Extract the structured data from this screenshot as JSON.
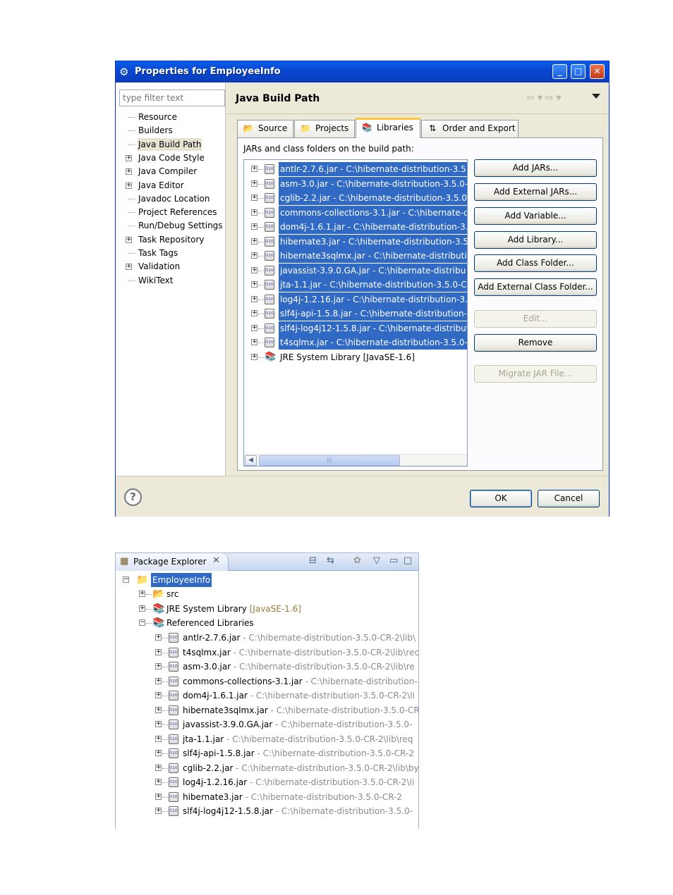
{
  "dialog": {
    "title": "Properties for EmployeeInfo",
    "filter_placeholder": "type filter text",
    "nav_items": [
      {
        "label": "Resource",
        "expandable": false
      },
      {
        "label": "Builders",
        "expandable": false
      },
      {
        "label": "Java Build Path",
        "expandable": false,
        "selected": true
      },
      {
        "label": "Java Code Style",
        "expandable": true
      },
      {
        "label": "Java Compiler",
        "expandable": true
      },
      {
        "label": "Java Editor",
        "expandable": true
      },
      {
        "label": "Javadoc Location",
        "expandable": false
      },
      {
        "label": "Project References",
        "expandable": false
      },
      {
        "label": "Run/Debug Settings",
        "expandable": false
      },
      {
        "label": "Task Repository",
        "expandable": true
      },
      {
        "label": "Task Tags",
        "expandable": false
      },
      {
        "label": "Validation",
        "expandable": true
      },
      {
        "label": "WikiText",
        "expandable": false
      }
    ],
    "page_title": "Java Build Path",
    "tabs": [
      {
        "label": "Source",
        "icon": "source-folder-icon"
      },
      {
        "label": "Projects",
        "icon": "projects-icon"
      },
      {
        "label": "Libraries",
        "icon": "libraries-icon",
        "active": true
      },
      {
        "label": "Order and Export",
        "icon": "order-export-icon"
      }
    ],
    "panel_caption": "JARs and class folders on the build path:",
    "jars": [
      "antlr-2.7.6.jar - C:\\hibernate-distribution-3.5",
      "asm-3.0.jar - C:\\hibernate-distribution-3.5.0-",
      "cglib-2.2.jar - C:\\hibernate-distribution-3.5.0",
      "commons-collections-3.1.jar - C:\\hibernate-di",
      "dom4j-1.6.1.jar - C:\\hibernate-distribution-3.",
      "hibernate3.jar - C:\\hibernate-distribution-3.5",
      "hibernate3sqlmx.jar - C:\\hibernate-distributio",
      "javassist-3.9.0.GA.jar - C:\\hibernate-distribu",
      "jta-1.1.jar - C:\\hibernate-distribution-3.5.0-C",
      "log4j-1.2.16.jar - C:\\hibernate-distribution-3.",
      "slf4j-api-1.5.8.jar - C:\\hibernate-distribution-",
      "slf4j-log4j12-1.5.8.jar - C:\\hibernate-distribut",
      "t4sqlmx.jar - C:\\hibernate-distribution-3.5.0-"
    ],
    "jre_entry": "JRE System Library [JavaSE-1.6]",
    "buttons": {
      "add_jars": "Add JARs...",
      "add_external_jars": "Add External JARs...",
      "add_variable": "Add Variable...",
      "add_library": "Add Library...",
      "add_class_folder": "Add Class Folder...",
      "add_external_class_folder": "Add External Class Folder...",
      "edit": "Edit...",
      "remove": "Remove",
      "migrate_jar": "Migrate JAR File..."
    },
    "ok": "OK",
    "cancel": "Cancel"
  },
  "package_explorer": {
    "title": "Package Explorer",
    "project": "EmployeeInfo",
    "src": "src",
    "jre_name": "JRE System Library",
    "jre_tag": "[JavaSE-1.6]",
    "referenced_libraries": "Referenced Libraries",
    "libraries": [
      {
        "name": "antlr-2.7.6.jar",
        "path": " - C:\\hibernate-distribution-3.5.0-CR-2\\lib\\"
      },
      {
        "name": "t4sqlmx.jar",
        "path": " - C:\\hibernate-distribution-3.5.0-CR-2\\lib\\rec"
      },
      {
        "name": "asm-3.0.jar",
        "path": " - C:\\hibernate-distribution-3.5.0-CR-2\\lib\\re"
      },
      {
        "name": "commons-collections-3.1.jar",
        "path": " - C:\\hibernate-distribution-3"
      },
      {
        "name": "dom4j-1.6.1.jar",
        "path": " - C:\\hibernate-distribution-3.5.0-CR-2\\li"
      },
      {
        "name": "hibernate3sqlmx.jar",
        "path": " - C:\\hibernate-distribution-3.5.0-CR"
      },
      {
        "name": "javassist-3.9.0.GA.jar",
        "path": " - C:\\hibernate-distribution-3.5.0-"
      },
      {
        "name": "jta-1.1.jar",
        "path": " - C:\\hibernate-distribution-3.5.0-CR-2\\lib\\req"
      },
      {
        "name": "slf4j-api-1.5.8.jar",
        "path": " - C:\\hibernate-distribution-3.5.0-CR-2"
      },
      {
        "name": "cglib-2.2.jar",
        "path": " - C:\\hibernate-distribution-3.5.0-CR-2\\lib\\by"
      },
      {
        "name": "log4j-1.2.16.jar",
        "path": " - C:\\hibernate-distribution-3.5.0-CR-2\\li"
      },
      {
        "name": "hibernate3.jar",
        "path": " - C:\\hibernate-distribution-3.5.0-CR-2"
      },
      {
        "name": "slf4j-log4j12-1.5.8.jar",
        "path": " - C:\\hibernate-distribution-3.5.0-"
      }
    ]
  },
  "colors": {
    "selection": "#316ac5",
    "titlebar": "#0848d3",
    "dialog_bg": "#ece9d8"
  }
}
